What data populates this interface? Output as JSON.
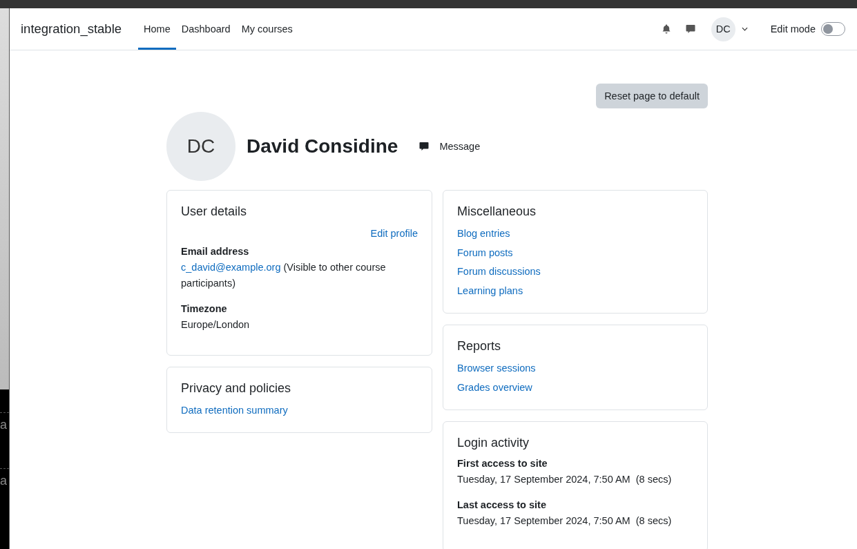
{
  "background_window": {
    "texts": [
      "a",
      "a"
    ]
  },
  "navbar": {
    "site_name": "integration_stable",
    "links": [
      {
        "label": "Home",
        "selected": true
      },
      {
        "label": "Dashboard",
        "selected": false
      },
      {
        "label": "My courses",
        "selected": false
      }
    ],
    "user_initials": "DC",
    "edit_mode": {
      "label": "Edit mode",
      "on": false
    }
  },
  "reset_button": "Reset page to default",
  "profile": {
    "initials": "DC",
    "name": "David Considine",
    "message_label": "Message"
  },
  "left_cards": [
    {
      "kind": "details",
      "title": "User details",
      "action": "Edit profile",
      "fields": [
        {
          "label": "Email address",
          "link": "c_david@example.org",
          "value": " (Visible to other course participants)"
        },
        {
          "label": "Timezone",
          "value": "Europe/London"
        }
      ]
    },
    {
      "kind": "links",
      "title": "Privacy and policies",
      "links": [
        "Data retention summary"
      ]
    }
  ],
  "right_cards": [
    {
      "kind": "links",
      "title": "Miscellaneous",
      "links": [
        "Blog entries",
        "Forum posts",
        "Forum discussions",
        "Learning plans"
      ]
    },
    {
      "kind": "links",
      "title": "Reports",
      "links": [
        "Browser sessions",
        "Grades overview"
      ]
    },
    {
      "kind": "details",
      "title": "Login activity",
      "fields": [
        {
          "label": "First access to site",
          "value": "Tuesday, 17 September 2024, 7:50 AM  (8 secs)"
        },
        {
          "label": "Last access to site",
          "value": "Tuesday, 17 September 2024, 7:50 AM  (8 secs)"
        }
      ]
    }
  ]
}
